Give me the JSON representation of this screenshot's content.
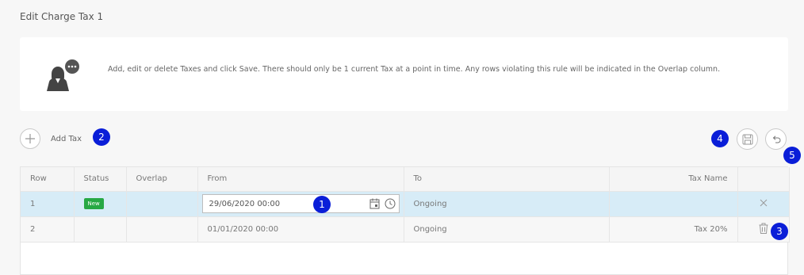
{
  "page": {
    "title": "Edit Charge Tax 1"
  },
  "info": {
    "icon": "support-agent-chat-icon",
    "text": "Add, edit or delete Taxes and click Save. There should only be 1 current Tax at a point in time. Any rows violating this rule will be indicated in the Overlap column."
  },
  "toolbar": {
    "add_label": "Add Tax",
    "add_icon": "plus-icon",
    "save_icon": "save-icon",
    "undo_icon": "undo-icon"
  },
  "badges": [
    "1",
    "2",
    "3",
    "4",
    "5"
  ],
  "badge_color": "#0a1ed8",
  "table": {
    "columns": [
      "Row",
      "Status",
      "Overlap",
      "From",
      "To",
      "Tax Name"
    ],
    "rows": [
      {
        "row": "1",
        "status": "New",
        "overlap": "",
        "from": "29/06/2020 00:00",
        "to": "Ongoing",
        "tax_name": "",
        "action_icon": "close-icon"
      },
      {
        "row": "2",
        "status": "",
        "overlap": "",
        "from": "01/01/2020 00:00",
        "to": "Ongoing",
        "tax_name": "Tax 20%",
        "action_icon": "trash-icon"
      }
    ]
  },
  "colors": {
    "selected_row": "#d7ecf7",
    "status_new": "#27a844"
  }
}
